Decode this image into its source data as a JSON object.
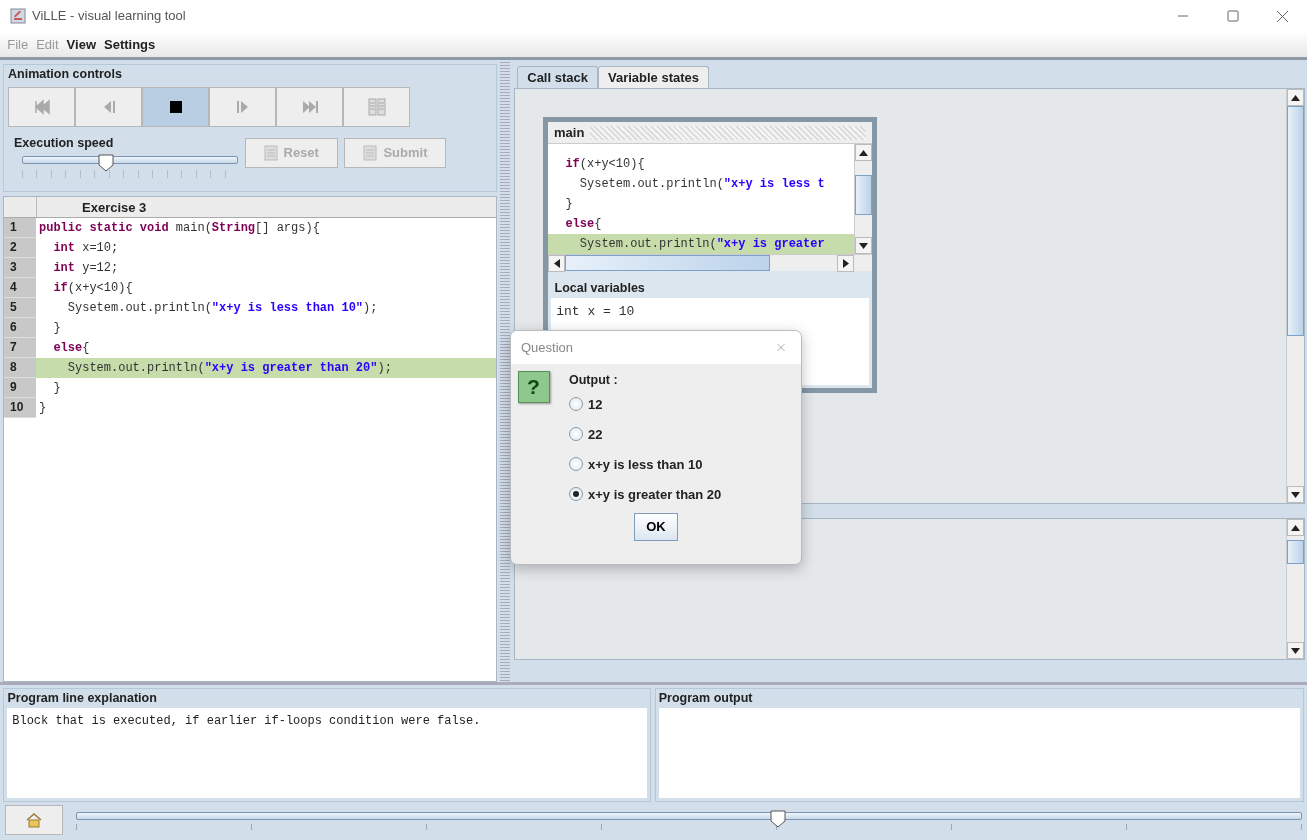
{
  "window": {
    "title": "ViLLE - visual learning tool"
  },
  "menu": [
    {
      "label": "File",
      "disabled": true
    },
    {
      "label": "Edit",
      "disabled": true
    },
    {
      "label": "View",
      "disabled": false
    },
    {
      "label": "Settings",
      "disabled": false
    }
  ],
  "animation_controls": {
    "title": "Animation controls",
    "buttons": [
      {
        "kind": "first",
        "selected": false
      },
      {
        "kind": "back",
        "selected": false
      },
      {
        "kind": "stop",
        "selected": true
      },
      {
        "kind": "forward",
        "selected": false
      },
      {
        "kind": "last",
        "selected": false
      },
      {
        "kind": "pages",
        "selected": false
      }
    ],
    "speed_label": "Execution speed",
    "speed": {
      "level": 0.39
    },
    "actions": [
      {
        "label": "Reset",
        "disabled": true
      },
      {
        "label": "Submit",
        "disabled": true
      }
    ]
  },
  "editor": {
    "title": "Exercise 3",
    "lines": [
      {
        "number": "1",
        "highlighted": false,
        "tokens": [
          {
            "kind": "kw",
            "text": "public static void"
          },
          {
            "kind": "text",
            "text": " main("
          },
          {
            "kind": "kw",
            "text": "String"
          },
          {
            "kind": "text",
            "text": "[] args){"
          }
        ]
      },
      {
        "number": "2",
        "highlighted": false,
        "tokens": [
          {
            "kind": "kw",
            "text": "  int"
          },
          {
            "kind": "text",
            "text": " x=10;"
          }
        ]
      },
      {
        "number": "3",
        "highlighted": false,
        "tokens": [
          {
            "kind": "kw",
            "text": "  int"
          },
          {
            "kind": "text",
            "text": " y=12;"
          }
        ]
      },
      {
        "number": "4",
        "highlighted": false,
        "tokens": [
          {
            "kind": "kw",
            "text": "  if"
          },
          {
            "kind": "text",
            "text": "(x+y<10){"
          }
        ]
      },
      {
        "number": "5",
        "highlighted": false,
        "tokens": [
          {
            "kind": "text",
            "text": "    Sysetem.out.println("
          },
          {
            "kind": "str",
            "text": "\"x+y is less than 10\""
          },
          {
            "kind": "text",
            "text": ");"
          }
        ]
      },
      {
        "number": "6",
        "highlighted": false,
        "tokens": [
          {
            "kind": "text",
            "text": "  }"
          }
        ]
      },
      {
        "number": "7",
        "highlighted": false,
        "tokens": [
          {
            "kind": "kw",
            "text": "  else"
          },
          {
            "kind": "text",
            "text": "{"
          }
        ]
      },
      {
        "number": "8",
        "highlighted": true,
        "tokens": [
          {
            "kind": "text",
            "text": "    System.out.println("
          },
          {
            "kind": "str",
            "text": "\"x+y is greater than 20\""
          },
          {
            "kind": "text",
            "text": ");"
          }
        ]
      },
      {
        "number": "9",
        "highlighted": false,
        "tokens": [
          {
            "kind": "text",
            "text": "  }"
          }
        ]
      },
      {
        "number": "10",
        "highlighted": false,
        "tokens": [
          {
            "kind": "text",
            "text": "}"
          }
        ]
      }
    ]
  },
  "tabs": [
    {
      "label": "Call stack",
      "selected": true
    },
    {
      "label": "Variable states",
      "selected": false
    }
  ],
  "call_stack": {
    "frame_title": "main",
    "code_lines": [
      {
        "highlighted": false,
        "tokens": [
          {
            "kind": "kw",
            "text": "  if"
          },
          {
            "kind": "text",
            "text": "(x+y<10){"
          }
        ]
      },
      {
        "highlighted": false,
        "tokens": [
          {
            "kind": "text",
            "text": "    Sysetem.out.println("
          },
          {
            "kind": "str",
            "text": "\"x+y is less t"
          }
        ]
      },
      {
        "highlighted": false,
        "tokens": [
          {
            "kind": "text",
            "text": "  }"
          }
        ]
      },
      {
        "highlighted": false,
        "tokens": [
          {
            "kind": "kw",
            "text": "  else"
          },
          {
            "kind": "text",
            "text": "{"
          }
        ]
      },
      {
        "highlighted": true,
        "tokens": [
          {
            "kind": "text",
            "text": "    System.out.println("
          },
          {
            "kind": "str",
            "text": "\"x+y is greater"
          }
        ]
      }
    ],
    "locals_title": "Local variables",
    "locals": [
      "int x = 10"
    ]
  },
  "dialog": {
    "title": "Question",
    "icon_text": "?",
    "prompt": "Output :",
    "options": [
      {
        "label": "12",
        "selected": false
      },
      {
        "label": "22",
        "selected": false
      },
      {
        "label": "x+y is less than 10",
        "selected": false
      },
      {
        "label": "x+y is greater than 20",
        "selected": true
      }
    ],
    "button": "OK"
  },
  "explanation": {
    "title": "Program line explanation",
    "text": "Block that is executed, if earlier if-loops condition were false."
  },
  "output": {
    "title": "Program output"
  },
  "timeline": {
    "level": 0.573
  }
}
